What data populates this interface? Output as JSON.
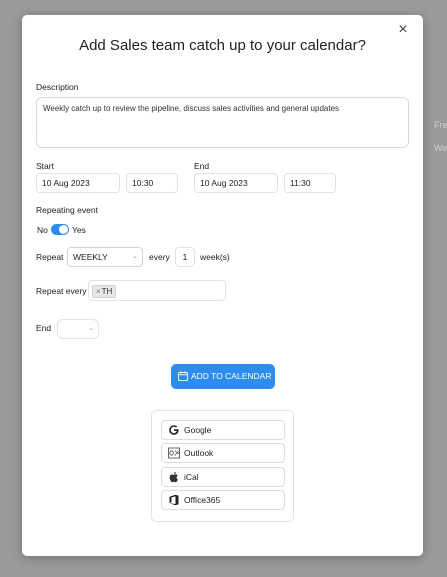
{
  "background": {
    "ghost_texts": [
      "Fre",
      "We"
    ]
  },
  "dialog": {
    "title": "Add Sales team catch up to your calendar?",
    "close_glyph": "×"
  },
  "description": {
    "label": "Description",
    "value": "Weekly catch up to review the pipeline, discuss sales activities and general updates"
  },
  "start": {
    "label": "Start",
    "date": "10 Aug 2023",
    "time": "10:30"
  },
  "end": {
    "label": "End",
    "date": "10 Aug 2023",
    "time": "11:30"
  },
  "repeating": {
    "label": "Repeating event",
    "no_label": "No",
    "yes_label": "Yes",
    "enabled": true
  },
  "repeat": {
    "label": "Repeat",
    "frequency": "WEEKLY",
    "every_label": "every",
    "interval": "1",
    "unit_label": "week(s)"
  },
  "repeat_every": {
    "label": "Repeat every",
    "tags": [
      "TH"
    ],
    "tag_remove_glyph": "×"
  },
  "end_rule": {
    "label": "End",
    "value": ""
  },
  "add_button": {
    "label": "ADD TO CALENDAR",
    "icon": "calendar-icon"
  },
  "providers": [
    {
      "label": "Google",
      "icon": "google-icon"
    },
    {
      "label": "Outlook",
      "icon": "outlook-icon"
    },
    {
      "label": "iCal",
      "icon": "apple-icon"
    },
    {
      "label": "Office365",
      "icon": "office365-icon"
    }
  ],
  "colors": {
    "accent": "#2d8cf0",
    "overlay": "#9a9a9a"
  }
}
